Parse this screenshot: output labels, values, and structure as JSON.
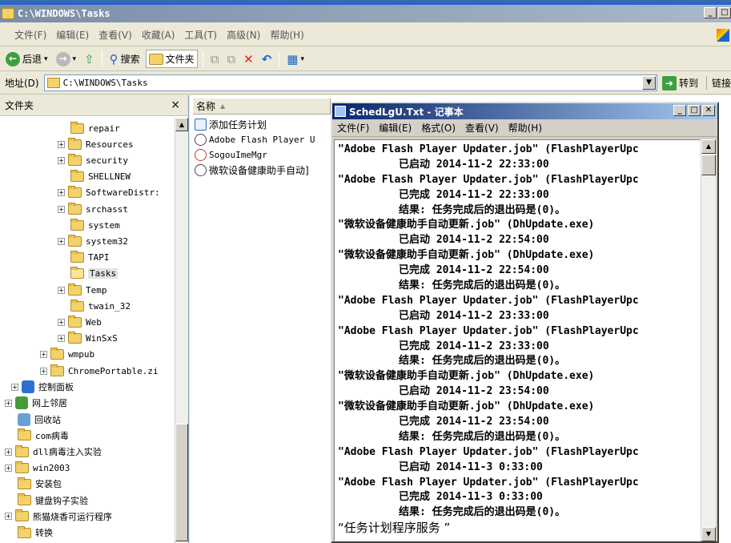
{
  "window": {
    "title": "C:\\WINDOWS\\Tasks",
    "minimize": "_",
    "maximize": "□"
  },
  "menu": [
    "文件(F)",
    "编辑(E)",
    "查看(V)",
    "收藏(A)",
    "工具(T)",
    "高级(N)",
    "帮助(H)"
  ],
  "toolbar": {
    "back_label": "后退",
    "search_label": "搜索",
    "folders_label": "文件夹"
  },
  "address": {
    "label": "地址(D)",
    "value": "C:\\WINDOWS\\Tasks",
    "go_label": "转到",
    "links_label": "链接"
  },
  "folders": {
    "header": "文件夹",
    "close": "×",
    "items": [
      {
        "label": "repair",
        "expander": ""
      },
      {
        "label": "Resources",
        "expander": "+"
      },
      {
        "label": "security",
        "expander": "+"
      },
      {
        "label": "SHELLNEW",
        "expander": ""
      },
      {
        "label": "SoftwareDistr:",
        "expander": "+"
      },
      {
        "label": "srchasst",
        "expander": "+"
      },
      {
        "label": "system",
        "expander": ""
      },
      {
        "label": "system32",
        "expander": "+"
      },
      {
        "label": "TAPI",
        "expander": ""
      },
      {
        "label": "Tasks",
        "expander": "",
        "selected": true
      },
      {
        "label": "Temp",
        "expander": "+"
      },
      {
        "label": "twain_32",
        "expander": ""
      },
      {
        "label": "Web",
        "expander": "+"
      },
      {
        "label": "WinSxS",
        "expander": "+"
      },
      {
        "label": "wmpub",
        "expander": "+"
      },
      {
        "label": "ChromePortable.zi",
        "expander": "+"
      },
      {
        "label": "控制面板",
        "expander": "+"
      },
      {
        "label": "网上邻居",
        "expander": "+"
      },
      {
        "label": "回收站",
        "expander": ""
      },
      {
        "label": "com病毒",
        "expander": ""
      },
      {
        "label": "dll病毒注入实验",
        "expander": "+"
      },
      {
        "label": "win2003",
        "expander": "+"
      },
      {
        "label": "安装包",
        "expander": ""
      },
      {
        "label": "键盘钩子实验",
        "expander": ""
      },
      {
        "label": "熊猫烧香可运行程序",
        "expander": "+"
      },
      {
        "label": "转换",
        "expander": ""
      }
    ]
  },
  "file_list": {
    "column_name": "名称",
    "sort_indicator": "▲",
    "files": [
      "添加任务计划",
      "Adobe Flash Player Up",
      "SogouImeMgr",
      "微软设备健康助手自动]"
    ]
  },
  "notepad": {
    "title": "SchedLgU.Txt - 记事本",
    "menu": [
      "文件(F)",
      "编辑(E)",
      "格式(O)",
      "查看(V)",
      "帮助(H)"
    ],
    "lines": [
      {
        "text": "\"Adobe Flash Player Updater.job\" (FlashPlayerUpc",
        "indent": false
      },
      {
        "text": "已启动 2014-11-2 22:33:00",
        "indent": true
      },
      {
        "text": "\"Adobe Flash Player Updater.job\" (FlashPlayerUpc",
        "indent": false
      },
      {
        "text": "已完成 2014-11-2 22:33:00",
        "indent": true
      },
      {
        "text": "结果: 任务完成后的退出码是(0)。",
        "indent": true
      },
      {
        "text": "\"微软设备健康助手自动更新.job\" (DhUpdate.exe)",
        "indent": false
      },
      {
        "text": "已启动 2014-11-2 22:54:00",
        "indent": true
      },
      {
        "text": "\"微软设备健康助手自动更新.job\" (DhUpdate.exe)",
        "indent": false
      },
      {
        "text": "已完成 2014-11-2 22:54:00",
        "indent": true
      },
      {
        "text": "结果: 任务完成后的退出码是(0)。",
        "indent": true
      },
      {
        "text": "\"Adobe Flash Player Updater.job\" (FlashPlayerUpc",
        "indent": false
      },
      {
        "text": "已启动 2014-11-2 23:33:00",
        "indent": true
      },
      {
        "text": "\"Adobe Flash Player Updater.job\" (FlashPlayerUpc",
        "indent": false
      },
      {
        "text": "已完成 2014-11-2 23:33:00",
        "indent": true
      },
      {
        "text": "结果: 任务完成后的退出码是(0)。",
        "indent": true
      },
      {
        "text": "\"微软设备健康助手自动更新.job\" (DhUpdate.exe)",
        "indent": false
      },
      {
        "text": "已启动 2014-11-2 23:54:00",
        "indent": true
      },
      {
        "text": "\"微软设备健康助手自动更新.job\" (DhUpdate.exe)",
        "indent": false
      },
      {
        "text": "已完成 2014-11-2 23:54:00",
        "indent": true
      },
      {
        "text": "结果: 任务完成后的退出码是(0)。",
        "indent": true
      },
      {
        "text": "\"Adobe Flash Player Updater.job\" (FlashPlayerUpc",
        "indent": false
      },
      {
        "text": "已启动 2014-11-3 0:33:00",
        "indent": true
      },
      {
        "text": "\"Adobe Flash Player Updater.job\" (FlashPlayerUpc",
        "indent": false
      },
      {
        "text": "已完成 2014-11-3 0:33:00",
        "indent": true
      },
      {
        "text": "结果: 任务完成后的退出码是(0)。",
        "indent": true
      },
      {
        "text": "“任务计划程序服务 ”",
        "indent": false,
        "plain": true
      }
    ]
  }
}
